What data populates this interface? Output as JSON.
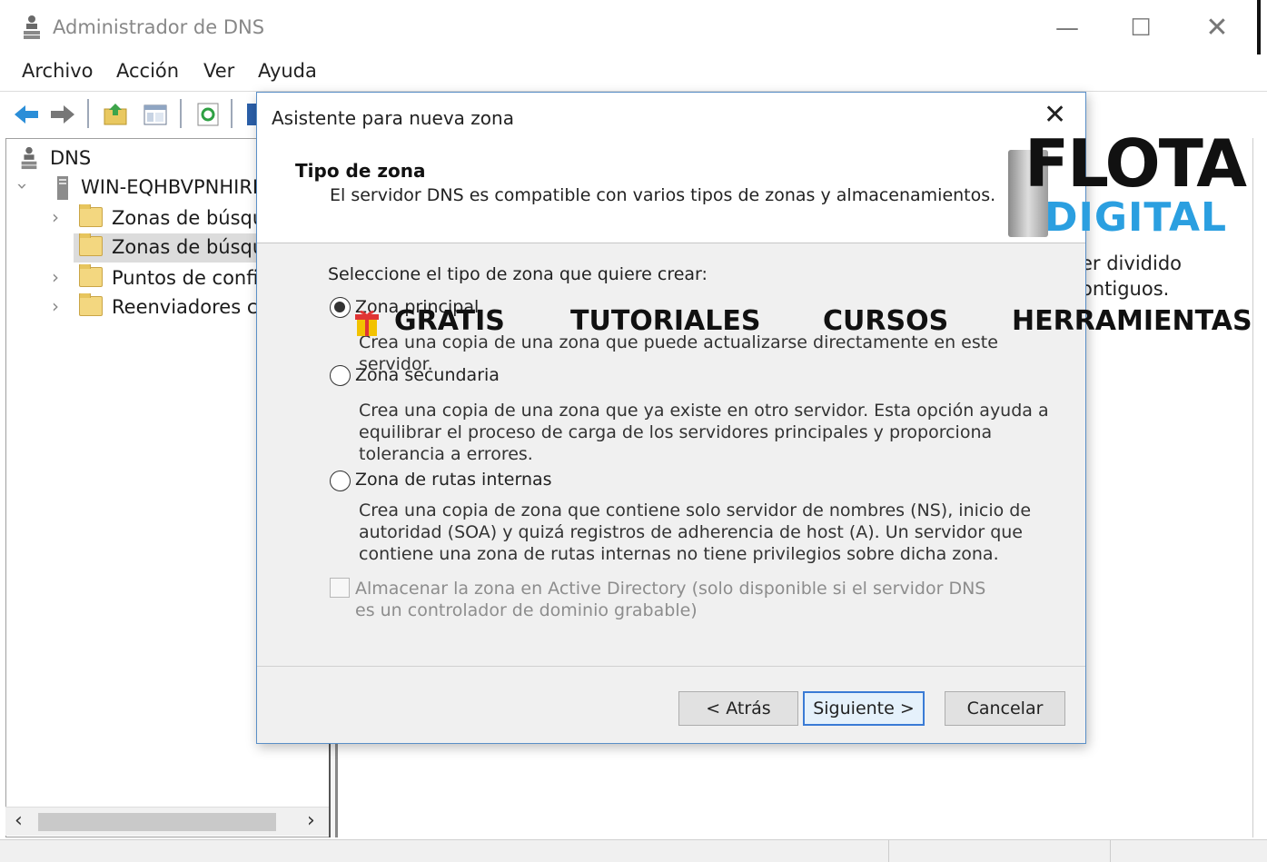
{
  "window": {
    "title": "Administrador de DNS",
    "minimize": "—",
    "maximize": "☐",
    "close": "✕"
  },
  "menu": {
    "items": [
      "Archivo",
      "Acción",
      "Ver",
      "Ayuda"
    ]
  },
  "tree": {
    "root": "DNS",
    "server": "WIN-EQHBVPNHIRF",
    "children": [
      "Zonas de búsque",
      "Zonas de búsque",
      "Puntos de confia",
      "Reenviadores co"
    ]
  },
  "right_pane": {
    "fragment_1": "er dividido",
    "fragment_2": "ontiguos."
  },
  "dialog": {
    "title": "Asistente para nueva zona",
    "close": "✕",
    "heading": "Tipo de zona",
    "subheading": "El servidor DNS es compatible con varios tipos de zonas y almacenamientos.",
    "prompt": "Seleccione el tipo de zona que quiere crear:",
    "options": [
      {
        "label": "Zona principal",
        "checked": true,
        "description": "Crea una copia de una zona que puede actualizarse directamente en este servidor."
      },
      {
        "label": "Zona secundaria",
        "checked": false,
        "description": "Crea una copia de una zona que ya existe en otro servidor. Esta opción ayuda a equilibrar el proceso de carga de los servidores principales y proporciona tolerancia a errores."
      },
      {
        "label": "Zona de rutas internas",
        "checked": false,
        "description": "Crea una copia de zona que contiene solo servidor de nombres (NS), inicio de autoridad (SOA) y quizá registros de adherencia de host (A). Un servidor que contiene una zona de rutas internas no tiene privilegios sobre dicha zona."
      }
    ],
    "store_ad": {
      "label": "Almacenar la zona en Active Directory (solo disponible si el servidor DNS es un controlador de dominio grabable)",
      "checked": false,
      "enabled": false
    },
    "buttons": {
      "back": "< Atrás",
      "next": "Siguiente >",
      "cancel": "Cancelar"
    }
  },
  "watermark": {
    "brand_line1": "FLOTA",
    "brand_line2": "DIGITAL",
    "nav": [
      "GRATIS",
      "TUTORIALES",
      "CURSOS",
      "HERRAMIENTAS"
    ],
    "brand_color": "#2b9fe0"
  },
  "colors": {
    "dialog_border": "#5a8fc7",
    "default_button_border": "#3a7bd5",
    "selected_tree_row": "#dcdcdc"
  }
}
